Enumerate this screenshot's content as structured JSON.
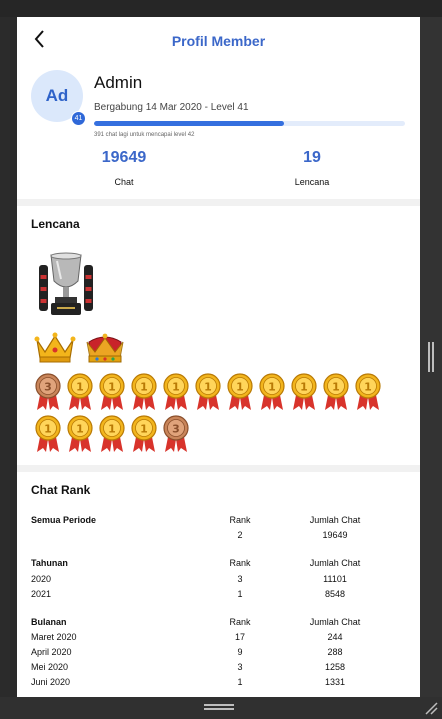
{
  "header": {
    "title": "Profil Member"
  },
  "profile": {
    "avatar_initials": "Ad",
    "level_badge": "41",
    "name": "Admin",
    "since": "Bergabung 14 Mar 2020 - Level 41",
    "progress_fraction": 0.61,
    "progress_note": "391 chat lagi untuk mencapai level 42",
    "stats": [
      {
        "value": "19649",
        "label": "Chat"
      },
      {
        "value": "19",
        "label": "Lencana"
      }
    ]
  },
  "badges": {
    "title": "Lencana",
    "trophy": "trophy-icon",
    "crowns": [
      "crown-gold",
      "crown-red"
    ],
    "medals_row1": [
      3,
      1,
      1,
      1,
      1,
      1,
      1,
      1,
      1,
      1,
      1
    ],
    "medals_row2": [
      1,
      1,
      1,
      1,
      3
    ]
  },
  "chat_rank": {
    "title": "Chat Rank",
    "col_rank": "Rank",
    "col_chat": "Jumlah Chat",
    "all_time": {
      "label": "Semua Periode",
      "rank": "2",
      "chat": "19649"
    },
    "yearly": {
      "label": "Tahunan",
      "rows": [
        {
          "period": "2020",
          "rank": "3",
          "chat": "11101"
        },
        {
          "period": "2021",
          "rank": "1",
          "chat": "8548"
        }
      ]
    },
    "monthly": {
      "label": "Bulanan",
      "rows": [
        {
          "period": "Maret 2020",
          "rank": "17",
          "chat": "244"
        },
        {
          "period": "April 2020",
          "rank": "9",
          "chat": "288"
        },
        {
          "period": "Mei 2020",
          "rank": "3",
          "chat": "1258"
        },
        {
          "period": "Juni 2020",
          "rank": "1",
          "chat": "1331"
        }
      ]
    }
  },
  "colors": {
    "accent": "#3b67c9",
    "progress": "#3570df",
    "avatar_bg": "#dbe8fb"
  }
}
